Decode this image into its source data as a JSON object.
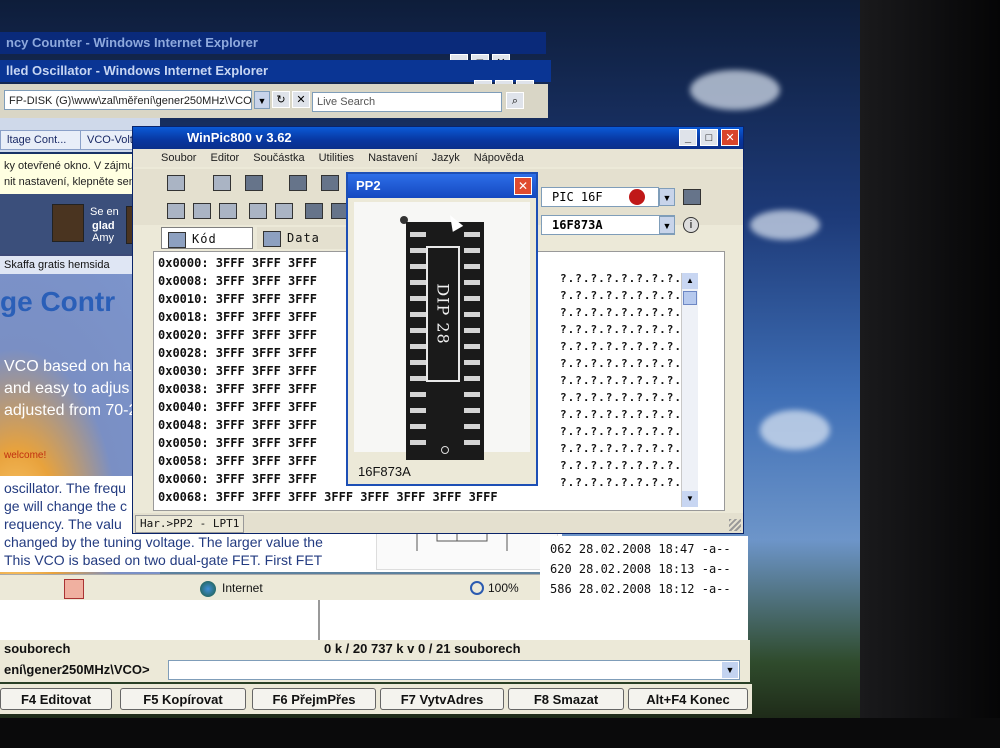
{
  "browser": {
    "window1_title": "ncy Counter - Windows Internet Explorer",
    "window2_title": "lled Oscillator - Windows Internet Explorer",
    "address": "FP-DISK (G)\\www\\zal\\měření\\gener250MHz\\VCO\\",
    "search_placeholder": "Live Search",
    "tabs": [
      "ltage Cont...",
      "VCO-Volta"
    ],
    "info_bar": [
      "ky otevřené okno. V zájmu och",
      "nit nastavení, klepněte sem..."
    ],
    "user1": "Se en",
    "user2": "glad",
    "user3": "Amy",
    "strip": "Skaffa gratis hemsida",
    "heading": "ge Contr",
    "lines": [
      "VCO based on hart",
      "and easy to adjus",
      "adjusted from 70-2"
    ],
    "welcome": "welcome!",
    "article": [
      "oscillator. The frequ",
      "ge will change the c",
      "requency. The valu",
      "changed by the tuning voltage. The larger value the",
      "This VCO is based on two dual-gate FET. First FET"
    ],
    "status_zone": "Internet",
    "zoom": "100%"
  },
  "commander": {
    "file_rows": [
      "062 28.02.2008 18:47 -a--",
      "620 28.02.2008 18:13 -a--",
      "586 28.02.2008 18:12 -a--"
    ],
    "left_count": "souborech",
    "right_count": "0 k / 20 737 k v 0 / 21 souborech",
    "cmd_path": "ení\\gener250MHz\\VCO>",
    "fkeys": [
      "F4 Editovat",
      "F5 Kopírovat",
      "F6 PřejmPřes",
      "F7 VytvAdres",
      "F8 Smazat",
      "Alt+F4 Konec"
    ]
  },
  "winpic": {
    "title": "WinPic800     v 3.62",
    "menu": [
      "Soubor",
      "Editor",
      "Součástka",
      "Utilities",
      "Nastavení",
      "Jazyk",
      "Nápověda"
    ],
    "tab_code": "Kód",
    "tab_data": "Data",
    "device_family": "PIC 16F",
    "device": "16F873A",
    "hex_rows": [
      "0x0000: 3FFF 3FFF 3FFF",
      "0x0008: 3FFF 3FFF 3FFF",
      "0x0010: 3FFF 3FFF 3FFF",
      "0x0018: 3FFF 3FFF 3FFF",
      "0x0020: 3FFF 3FFF 3FFF",
      "0x0028: 3FFF 3FFF 3FFF",
      "0x0030: 3FFF 3FFF 3FFF",
      "0x0038: 3FFF 3FFF 3FFF",
      "0x0040: 3FFF 3FFF 3FFF",
      "0x0048: 3FFF 3FFF 3FFF",
      "0x0050: 3FFF 3FFF 3FFF",
      "0x0058: 3FFF 3FFF 3FFF",
      "0x0060: 3FFF 3FFF 3FFF",
      "0x0068: 3FFF 3FFF 3FFF 3FFF 3FFF 3FFF 3FFF 3FFF"
    ],
    "ascii_rows": [
      "?.?.?.?.?.?.?.?.",
      "?.?.?.?.?.?.?.?.",
      "?.?.?.?.?.?.?.?.",
      "?.?.?.?.?.?.?.?.",
      "?.?.?.?.?.?.?.?.",
      "?.?.?.?.?.?.?.?.",
      "?.?.?.?.?.?.?.?.",
      "?.?.?.?.?.?.?.?.",
      "?.?.?.?.?.?.?.?.",
      "?.?.?.?.?.?.?.?.",
      "?.?.?.?.?.?.?.?.",
      "?.?.?.?.?.?.?.?.",
      "?.?.?.?.?.?.?.?."
    ],
    "status": "Har.>PP2 - LPT1"
  },
  "pp2_dialog": {
    "title": "PP2",
    "chip_label": "DIP 28",
    "device": "16F873A"
  }
}
